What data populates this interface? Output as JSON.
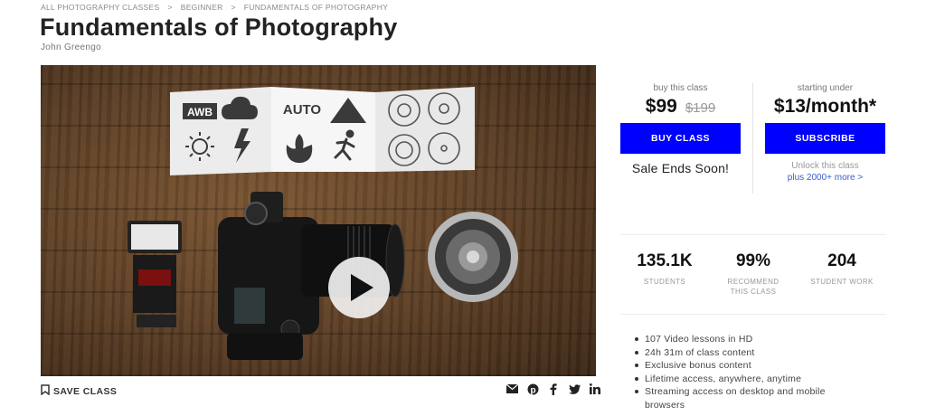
{
  "breadcrumb": [
    "ALL PHOTOGRAPHY CLASSES",
    "BEGINNER",
    "FUNDAMENTALS OF PHOTOGRAPHY"
  ],
  "breadcrumb_separator": ">",
  "course": {
    "title": "Fundamentals of Photography",
    "author": "John Greengo"
  },
  "video": {
    "card_labels": [
      "AWB",
      "AUTO"
    ]
  },
  "actions": {
    "save_label": "SAVE CLASS",
    "share_icons": [
      "email-icon",
      "pinterest-icon",
      "facebook-icon",
      "twitter-icon",
      "linkedin-icon"
    ]
  },
  "buy": {
    "caption": "buy this class",
    "price": "$99",
    "old_price": "$199",
    "button_label": "BUY CLASS",
    "sale_text": "Sale Ends Soon!"
  },
  "subscribe": {
    "caption": "starting under",
    "price": "$13/month*",
    "button_label": "SUBSCRIBE",
    "unlock_text": "Unlock this class",
    "more_link": "plus 2000+ more >"
  },
  "stats": [
    {
      "value": "135.1K",
      "label": "STUDENTS"
    },
    {
      "value": "99%",
      "label": "RECOMMEND THIS CLASS"
    },
    {
      "value": "204",
      "label": "STUDENT WORK"
    }
  ],
  "features": [
    "107 Video lessons in HD",
    "24h 31m of class content",
    "Exclusive bonus content",
    "Lifetime access, anywhere, anytime",
    "Streaming access on desktop and mobile browsers"
  ],
  "colors": {
    "accent": "#0000ff",
    "link": "#3a5fc8"
  }
}
